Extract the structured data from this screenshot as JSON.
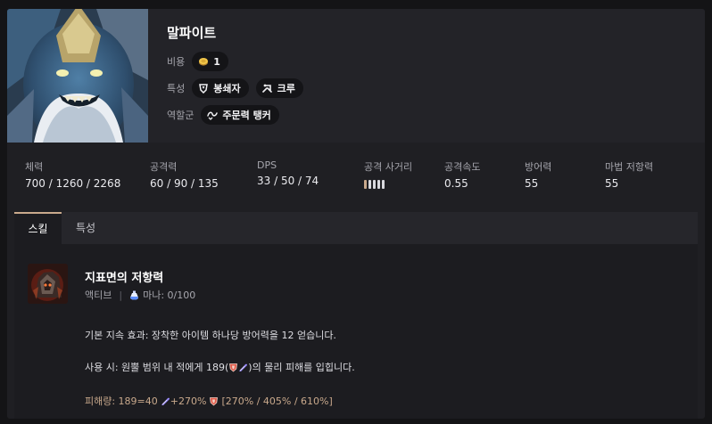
{
  "champion": {
    "name": "말파이트",
    "cost_label": "비용",
    "cost": "1",
    "traits_label": "특성",
    "traits": [
      "봉쇄자",
      "크루"
    ],
    "role_label": "역할군",
    "role": "주문력 탱커"
  },
  "stats": [
    {
      "label": "체력",
      "value": "700 / 1260 / 2268"
    },
    {
      "label": "공격력",
      "value": "60 / 90 / 135"
    },
    {
      "label": "DPS",
      "value": "33 / 50 / 74"
    },
    {
      "label": "공격 사거리",
      "range": 1,
      "range_max": 5
    },
    {
      "label": "공격속도",
      "value": "0.55"
    },
    {
      "label": "방어력",
      "value": "55"
    },
    {
      "label": "마법 저항력",
      "value": "55"
    }
  ],
  "tabs": [
    "스킬",
    "특성"
  ],
  "active_tab": "스킬",
  "skill": {
    "name": "지표면의 저항력",
    "type": "액티브",
    "mana": "마나: 0/100",
    "passive_text": "기본 지속 효과: 장착한 아이템 하나당 방어력을 12 얻습니다.",
    "active_text_before": "사용 시: 원뿔 범위 내 적에게 189(",
    "active_text_after": ")의 물리 피해를 입힙니다.",
    "damage_label": "피해량: 189=40",
    "damage_mid": "+270%",
    "damage_values": "[270% / 405% / 610%]"
  },
  "colors": {
    "accent": "#c9a98c",
    "background": "#1f1f23",
    "chip": "#141417"
  },
  "icons": {
    "cost": "coin-icon",
    "trait1": "shield-trait-icon",
    "trait2": "crew-trait-icon",
    "role": "spell-tank-icon",
    "mana": "mana-potion-icon",
    "ap": "ability-power-icon",
    "armor": "armor-icon"
  }
}
